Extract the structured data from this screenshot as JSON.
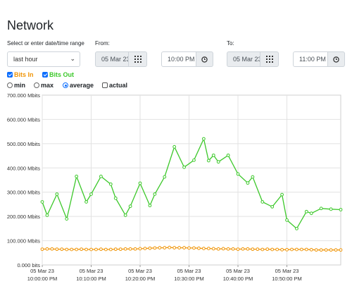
{
  "page": {
    "title": "Network"
  },
  "range": {
    "label": "Select or enter date/time range",
    "selected": "last hour"
  },
  "from": {
    "label": "From:",
    "date": "05 Mar 23",
    "time": "10:00 PM"
  },
  "to": {
    "label": "To:",
    "date": "05 Mar 23",
    "time": "11:00 PM"
  },
  "series_toggles": [
    {
      "label": "Bits In",
      "checked": true,
      "color": "#f0960a"
    },
    {
      "label": "Bits Out",
      "checked": true,
      "color": "#3cc82a"
    }
  ],
  "aggregation": {
    "options": [
      "min",
      "max",
      "average",
      "actual"
    ],
    "selected": "average",
    "actual_checked": false
  },
  "colors": {
    "accent": "#0d6efd",
    "bits_in": "#f0960a",
    "bits_out": "#3cc82a"
  },
  "chart_data": {
    "type": "line",
    "y_ticks": [
      "0.000 bits",
      "100.000 Mbits",
      "200.000 Mbits",
      "300.000 Mbits",
      "400.000 Mbits",
      "500.000 Mbits",
      "600.000 Mbits",
      "700.000 Mbits"
    ],
    "ylim": [
      0,
      700
    ],
    "y_unit": "Mbits",
    "x_ticks": [
      {
        "date": "05 Mar 23",
        "time": "10:00:00 PM",
        "minute": 0
      },
      {
        "date": "05 Mar 23",
        "time": "10:10:00 PM",
        "minute": 10
      },
      {
        "date": "05 Mar 23",
        "time": "10:20:00 PM",
        "minute": 20
      },
      {
        "date": "05 Mar 23",
        "time": "10:30:00 PM",
        "minute": 30
      },
      {
        "date": "05 Mar 23",
        "time": "10:40:00 PM",
        "minute": 40
      },
      {
        "date": "05 Mar 23",
        "time": "10:50:00 PM",
        "minute": 50
      }
    ],
    "xlim": [
      0,
      61
    ],
    "grid": true,
    "series": [
      {
        "name": "Bits Out",
        "color": "#3cc82a",
        "x": [
          0,
          1,
          3,
          5,
          7,
          9,
          10,
          12,
          14,
          15,
          17,
          18,
          20,
          22,
          23,
          25,
          27,
          29,
          31,
          33,
          34,
          35,
          36,
          38,
          40,
          42,
          43,
          45,
          47,
          49,
          50,
          52,
          54,
          55,
          57,
          59,
          61
        ],
        "y": [
          260,
          205,
          292,
          190,
          365,
          260,
          292,
          365,
          333,
          275,
          205,
          242,
          337,
          245,
          292,
          363,
          487,
          403,
          432,
          520,
          430,
          452,
          425,
          452,
          375,
          338,
          363,
          260,
          240,
          290,
          185,
          150,
          220,
          213,
          233,
          230,
          228
        ]
      },
      {
        "name": "Bits In",
        "color": "#f0960a",
        "x": [
          0,
          1,
          2,
          3,
          4,
          5,
          6,
          7,
          8,
          9,
          10,
          11,
          12,
          13,
          14,
          15,
          16,
          17,
          18,
          19,
          20,
          21,
          22,
          23,
          24,
          25,
          26,
          27,
          28,
          29,
          30,
          31,
          32,
          33,
          34,
          35,
          36,
          37,
          38,
          39,
          40,
          41,
          42,
          43,
          44,
          45,
          46,
          47,
          48,
          49,
          50,
          51,
          52,
          53,
          54,
          55,
          56,
          57,
          58,
          59,
          60,
          61
        ],
        "y": [
          65,
          66,
          66,
          65,
          65,
          64,
          64,
          64,
          65,
          64,
          64,
          64,
          65,
          64,
          64,
          65,
          65,
          66,
          66,
          66,
          67,
          68,
          69,
          70,
          71,
          71,
          72,
          71,
          71,
          71,
          70,
          70,
          69,
          68,
          68,
          67,
          66,
          67,
          66,
          66,
          65,
          66,
          66,
          65,
          65,
          64,
          65,
          64,
          64,
          63,
          63,
          64,
          64,
          64,
          64,
          63,
          62,
          62,
          62,
          62,
          62,
          62
        ]
      }
    ]
  }
}
